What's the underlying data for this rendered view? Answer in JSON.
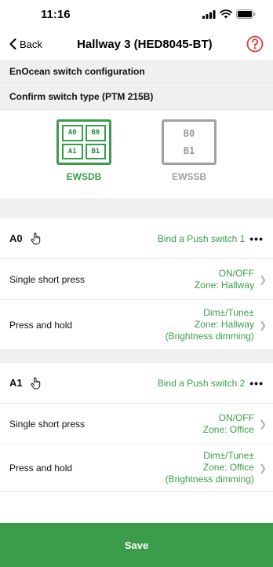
{
  "status_bar": {
    "time": "11:16"
  },
  "nav": {
    "back_label": "Back",
    "title": "Hallway 3 (HED8045-BT)"
  },
  "sections": {
    "config_title": "EnOcean switch configuration",
    "confirm_title": "Confirm switch type (PTM 215B)"
  },
  "switch_types": [
    {
      "label": "EWSDB",
      "selected": true,
      "cells": [
        "A0",
        "B0",
        "A1",
        "B1"
      ]
    },
    {
      "label": "EWSSB",
      "selected": false,
      "cells": [
        "B0",
        "B1"
      ]
    }
  ],
  "buttons": [
    {
      "name": "A0",
      "bind_label": "Bind a Push switch 1",
      "more": "•••",
      "actions": [
        {
          "label": "Single short press",
          "line1": "ON/OFF",
          "line2": "Zone: Hallway",
          "line3": ""
        },
        {
          "label": "Press and hold",
          "line1": "Dim±/Tune±",
          "line2": "Zone: Hallway",
          "line3": "(Brightness dimming)"
        }
      ]
    },
    {
      "name": "A1",
      "bind_label": "Bind a Push switch 2",
      "more": "•••",
      "actions": [
        {
          "label": "Single short press",
          "line1": "ON/OFF",
          "line2": "Zone: Office",
          "line3": ""
        },
        {
          "label": "Press and hold",
          "line1": "Dim±/Tune±",
          "line2": "Zone: Office",
          "line3": "(Brightness dimming)"
        }
      ]
    }
  ],
  "footer": {
    "save_label": "Save"
  },
  "colors": {
    "accent": "#3b9c4c",
    "help": "#e23b3b",
    "inactive": "#a0a0a0"
  }
}
